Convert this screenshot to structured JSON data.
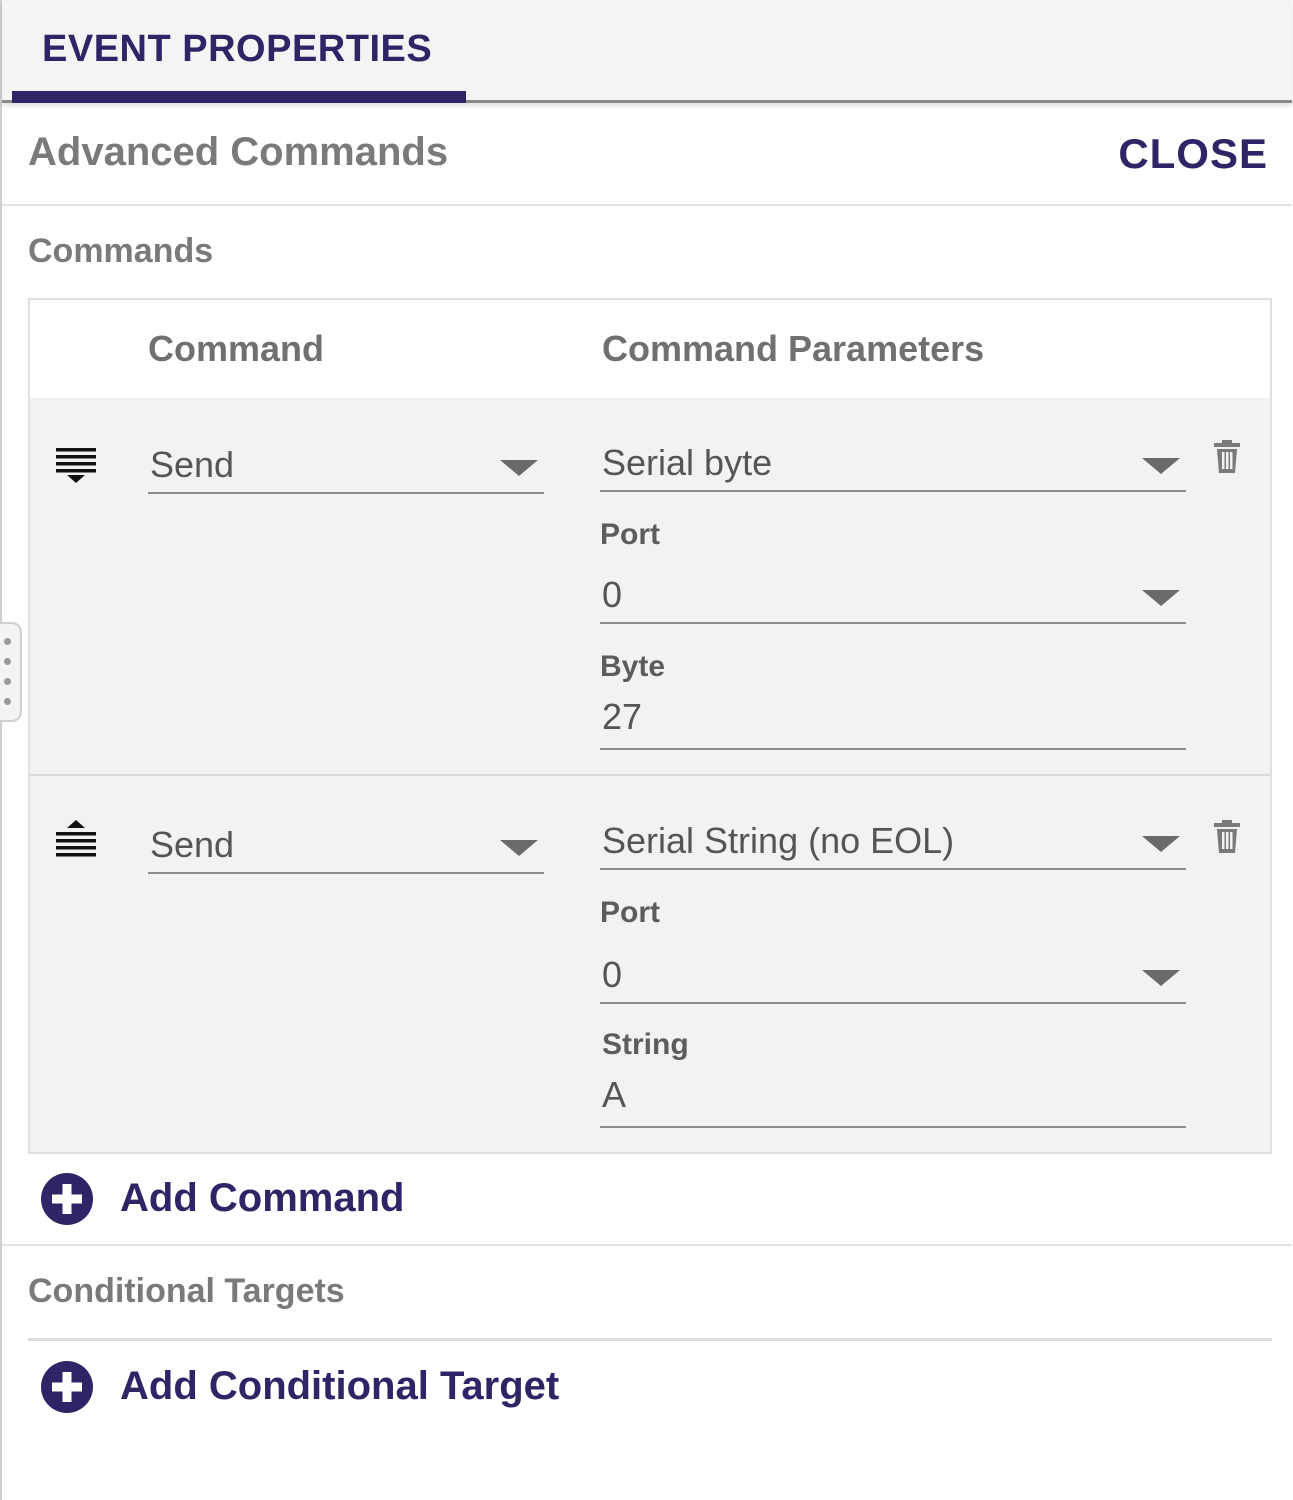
{
  "tabs": [
    {
      "label": "EVENT PROPERTIES",
      "active": true
    }
  ],
  "section": {
    "title": "Advanced Commands",
    "close_label": "CLOSE"
  },
  "commands": {
    "title": "Commands",
    "columns": [
      "Command",
      "Command Parameters"
    ],
    "rows": [
      {
        "reorder_icon": "move-down-icon",
        "command": "Send",
        "parameter_type": "Serial byte",
        "fields": [
          {
            "label": "Port",
            "value": "0",
            "kind": "select"
          },
          {
            "label": "Byte",
            "value": "27",
            "kind": "text"
          }
        ]
      },
      {
        "reorder_icon": "move-up-icon",
        "command": "Send",
        "parameter_type": "Serial String (no EOL)",
        "fields": [
          {
            "label": "Port",
            "value": "0",
            "kind": "select"
          },
          {
            "label": "String",
            "value": "A",
            "kind": "text"
          }
        ]
      }
    ],
    "add_label": "Add Command"
  },
  "conditional_targets": {
    "title": "Conditional Targets",
    "add_label": "Add Conditional Target"
  },
  "colors": {
    "accent": "#2f2566",
    "muted_text": "#7a7a7a",
    "row_bg": "#f2f2f2"
  }
}
